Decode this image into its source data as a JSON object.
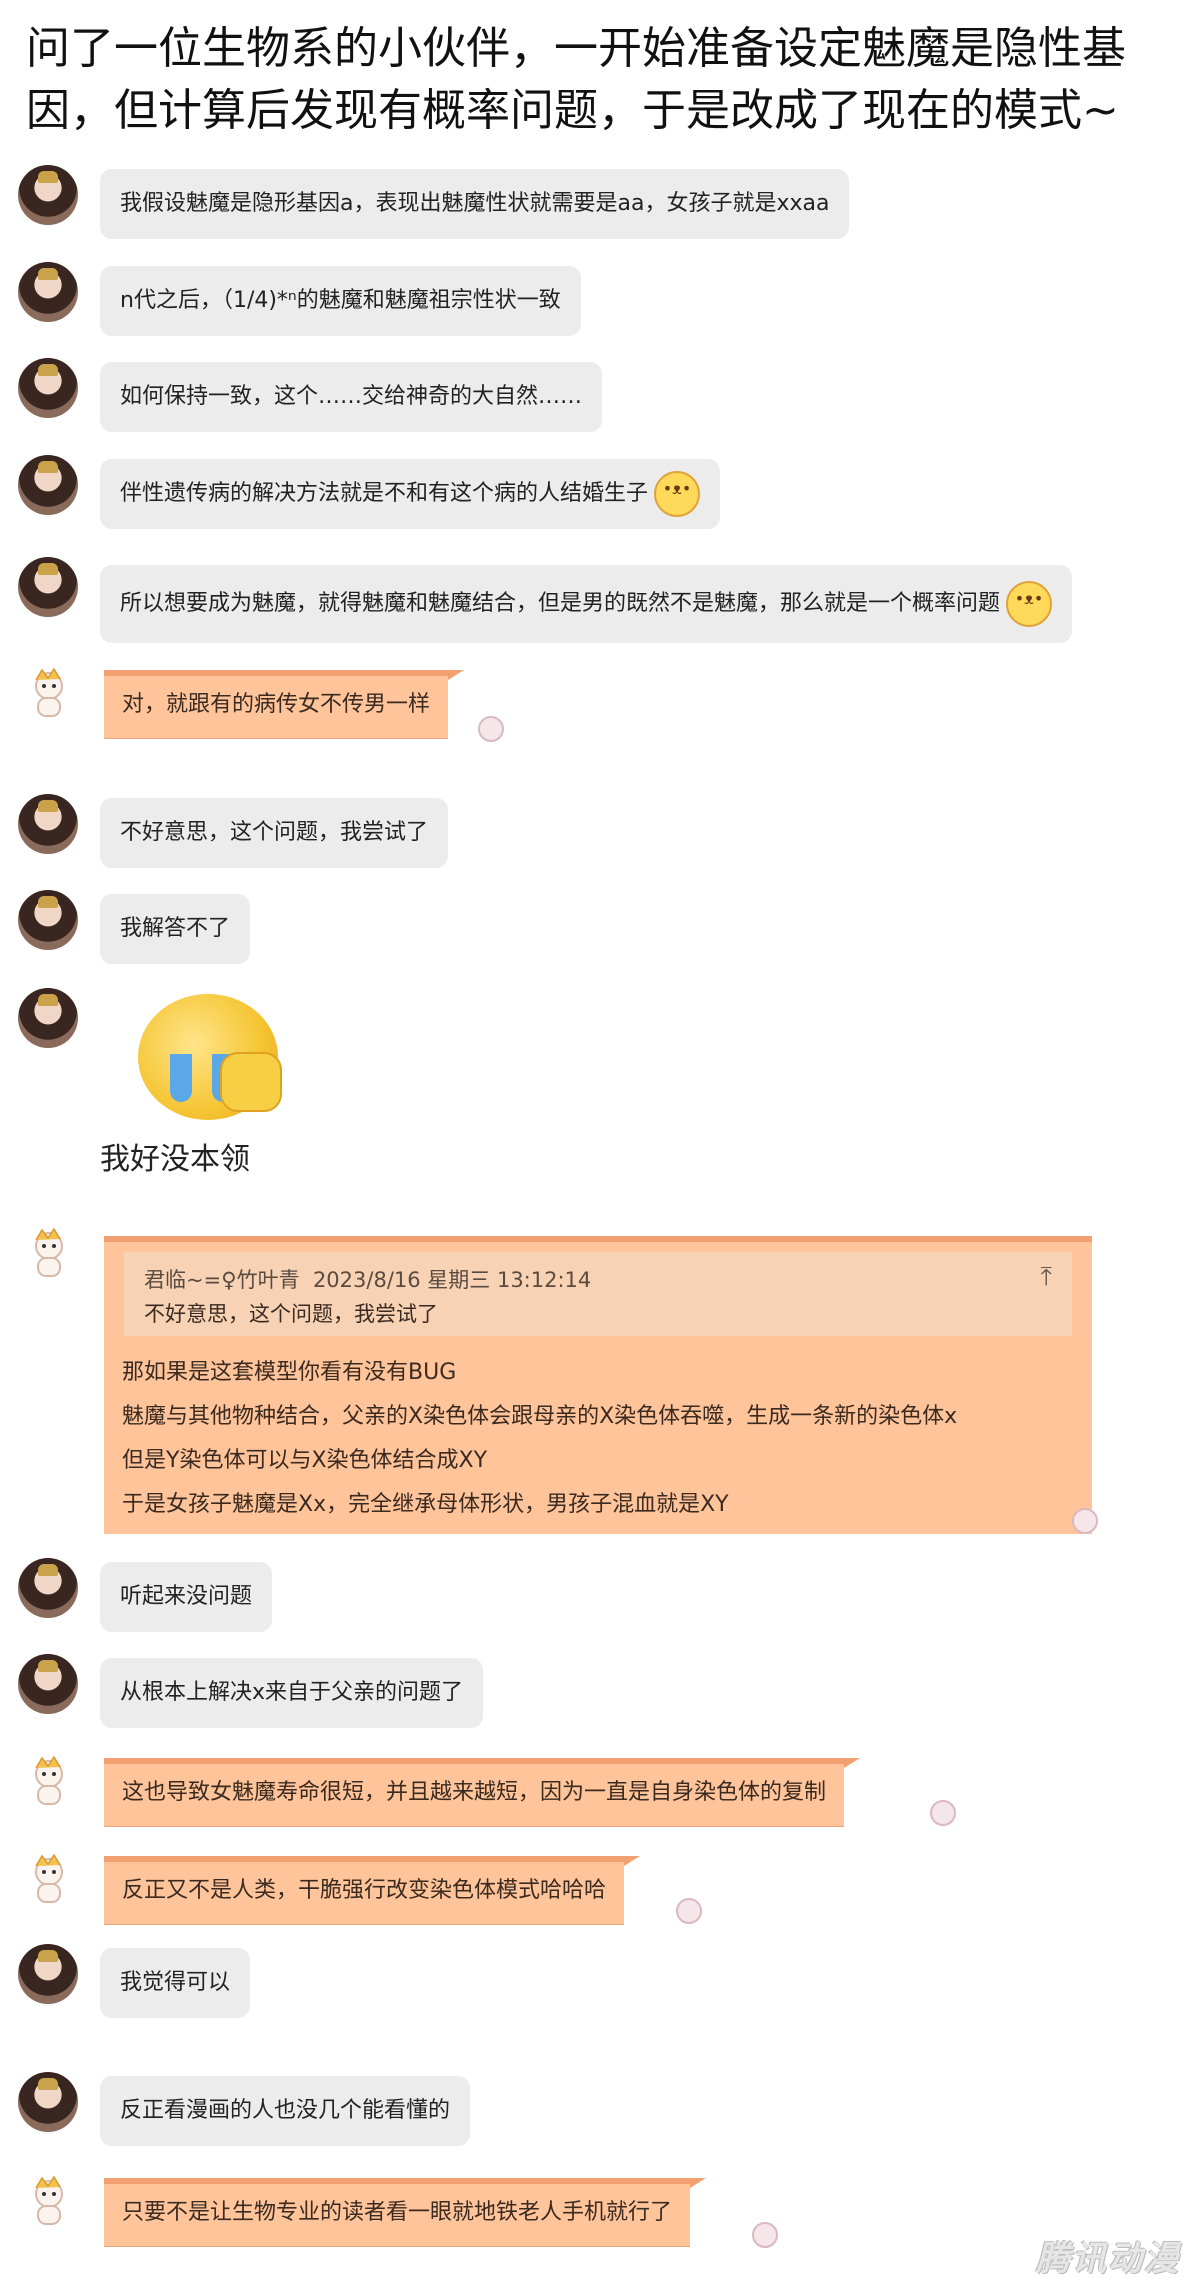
{
  "caption": "问了一位生物系的小伙伴，一开始准备设定魅魔是隐性基因，但计算后发现有概率问题，于是改成了现在的模式~",
  "messages": [
    {
      "side": "other",
      "text": "我假设魅魔是隐形基因a，表现出魅魔性状就需要是aa，女孩子就是xxaa"
    },
    {
      "side": "other",
      "text": "n代之后，（1/4)*ⁿ的魅魔和魅魔祖宗性状一致"
    },
    {
      "side": "other",
      "text": "如何保持一致，这个……交给神奇的大自然……"
    },
    {
      "side": "other",
      "text": "伴性遗传病的解决方法就是不和有这个病的人结婚生子",
      "emoji": "dog-face-icon"
    },
    {
      "side": "other",
      "text": "所以想要成为魅魔，就得魅魔和魅魔结合，但是男的既然不是魅魔，那么就是一个概率问题",
      "emoji": "dog-face-icon"
    },
    {
      "side": "me",
      "text": "对，就跟有的病传女不传男一样"
    },
    {
      "side": "other",
      "text": "不好意思，这个问题，我尝试了"
    },
    {
      "side": "other",
      "text": "我解答不了"
    },
    {
      "side": "other",
      "sticker": "crying-emoji-sticker",
      "sticker_text": "我好没本领"
    },
    {
      "side": "me",
      "quote": {
        "author": "君临~=♀竹叶青",
        "time": "2023/8/16 星期三 13:12:14",
        "text": "不好意思，这个问题，我尝试了"
      },
      "lines": [
        "那如果是这套模型你看有没有BUG",
        "魅魔与其他物种结合，父亲的X染色体会跟母亲的X染色体吞噬，生成一条新的染色体x",
        "但是Y染色体可以与X染色体结合成XY",
        "于是女孩子魅魔是Xx，完全继承母体形状，男孩子混血就是XY"
      ]
    },
    {
      "side": "other",
      "text": "听起来没问题"
    },
    {
      "side": "other",
      "text": "从根本上解决x来自于父亲的问题了"
    },
    {
      "side": "me",
      "text": "这也导致女魅魔寿命很短，并且越来越短，因为一直是自身染色体的复制"
    },
    {
      "side": "me",
      "text": "反正又不是人类，干脆强行改变染色体模式哈哈哈"
    },
    {
      "side": "other",
      "text": "我觉得可以"
    },
    {
      "side": "other",
      "text": "反正看漫画的人也没几个能看懂的"
    },
    {
      "side": "me",
      "text": "只要不是让生物专业的读者看一眼就地铁老人手机就行了"
    }
  ],
  "watermark": "腾讯动漫",
  "colors": {
    "gray_bubble": "#ececec",
    "orange_bubble": "#ffc49a",
    "orange_border": "#f3a070"
  }
}
